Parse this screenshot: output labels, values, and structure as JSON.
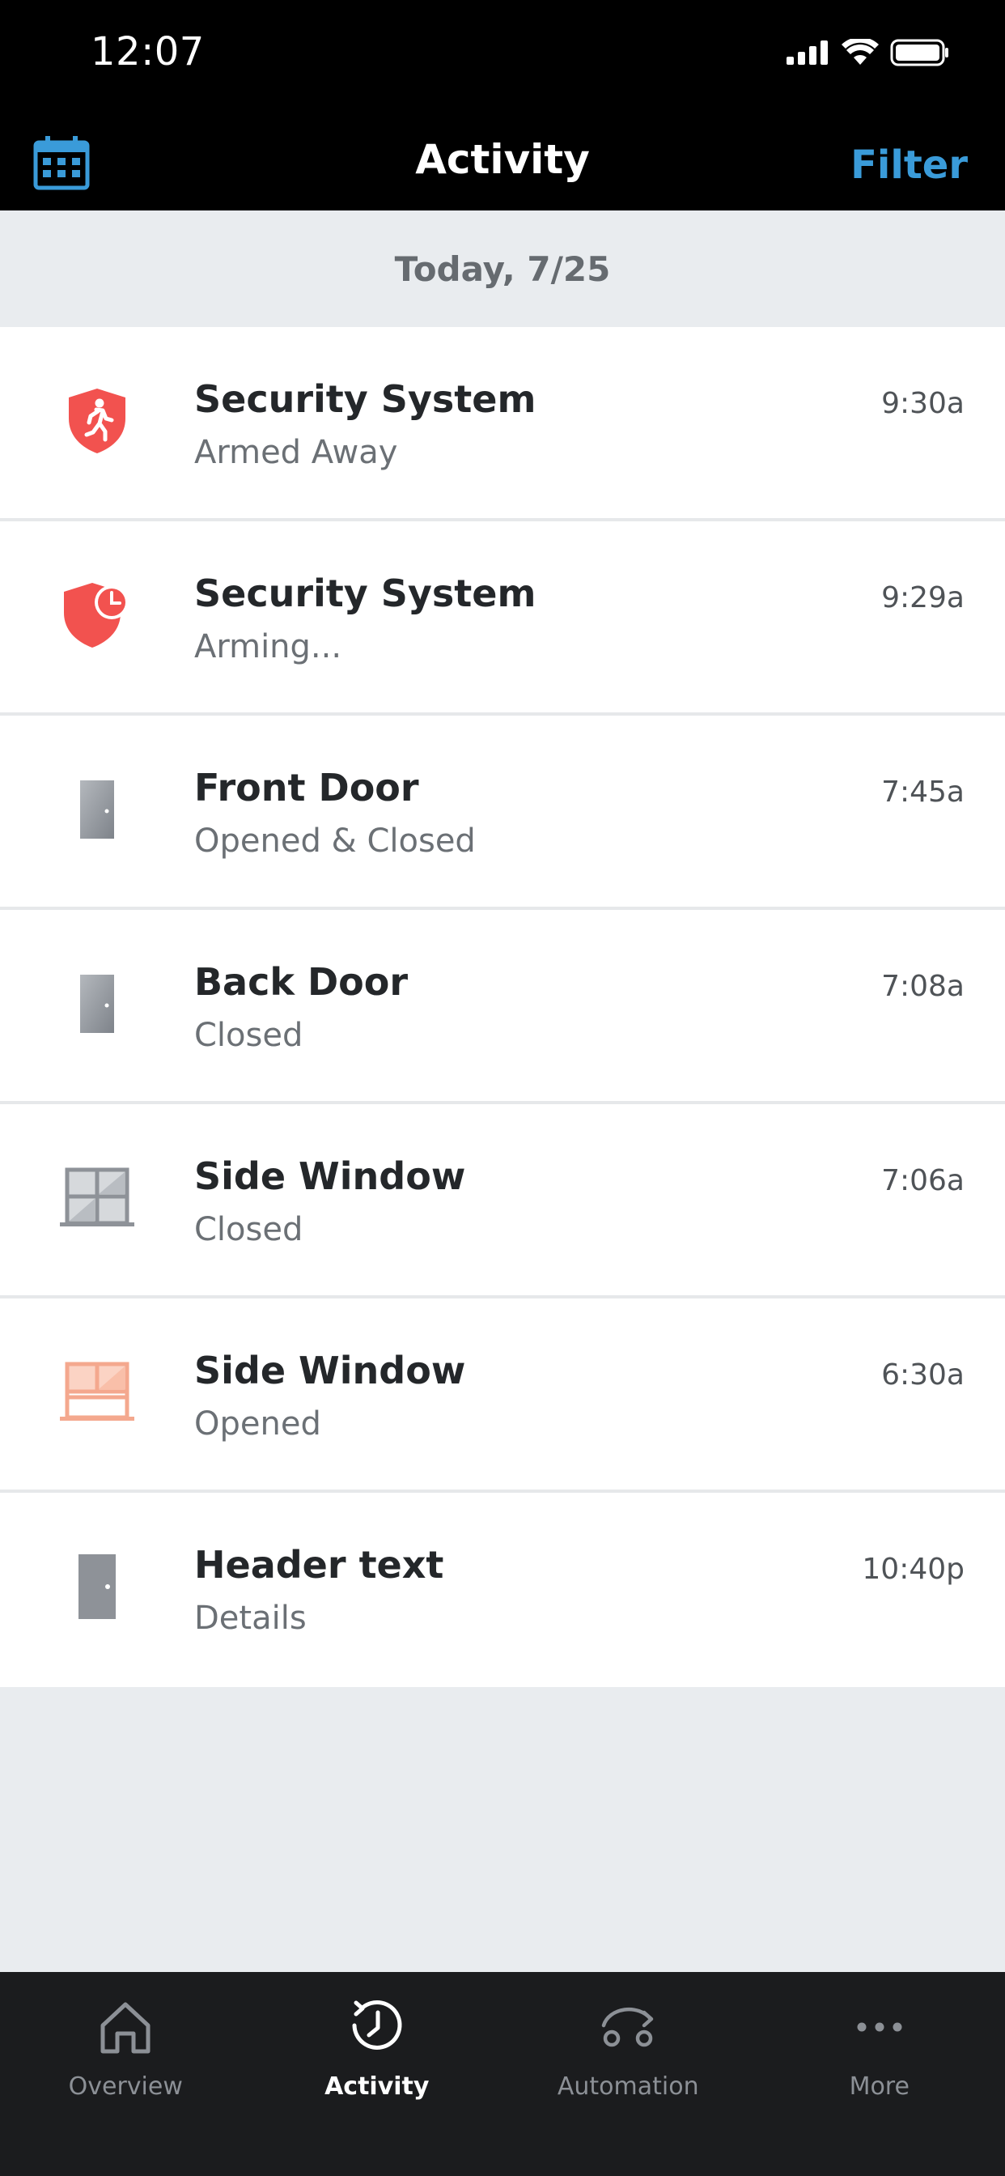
{
  "status_bar": {
    "time": "12:07"
  },
  "nav": {
    "title": "Activity",
    "filter_label": "Filter",
    "left_icon": "calendar-icon"
  },
  "date_header": "Today, 7/25",
  "colors": {
    "accent": "#3a9bd9",
    "alarm": "#f2524f",
    "window_open": "#f4a88e",
    "neutral_icon": "#8e9298"
  },
  "activity": [
    {
      "icon": "shield-walker-icon",
      "title": "Security System",
      "detail": "Armed Away",
      "time": "9:30a"
    },
    {
      "icon": "shield-clock-icon",
      "title": "Security System",
      "detail": "Arming...",
      "time": "9:29a"
    },
    {
      "icon": "door-icon",
      "title": "Front Door",
      "detail": "Opened & Closed",
      "time": "7:45a"
    },
    {
      "icon": "door-icon",
      "title": "Back Door",
      "detail": "Closed",
      "time": "7:08a"
    },
    {
      "icon": "window-closed-icon",
      "title": "Side Window",
      "detail": "Closed",
      "time": "7:06a"
    },
    {
      "icon": "window-open-icon",
      "title": "Side Window",
      "detail": "Opened",
      "time": "6:30a"
    },
    {
      "icon": "door-icon",
      "title": "Header text",
      "detail": "Details",
      "time": "10:40p"
    }
  ],
  "tabs": [
    {
      "label": "Overview",
      "icon": "home-icon"
    },
    {
      "label": "Activity",
      "icon": "activity-clock-icon",
      "active": true
    },
    {
      "label": "Automation",
      "icon": "automation-icon"
    },
    {
      "label": "More",
      "icon": "more-dots-icon"
    }
  ]
}
